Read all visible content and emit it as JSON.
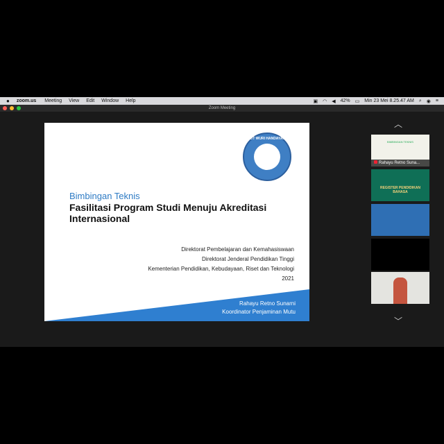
{
  "menubar": {
    "app": "zoom.us",
    "items": [
      "Meeting",
      "View",
      "Edit",
      "Window",
      "Help"
    ],
    "battery": "42%",
    "clock": "Min 23 Mei  8.25.47 AM"
  },
  "window": {
    "title": "Zoom Meeting"
  },
  "slide": {
    "logo_text": "TUT WURI HANDAYANI",
    "subtitle": "Bimbingan Teknis",
    "title": "Fasilitasi Program Studi Menuju Akreditasi Internasional",
    "institution_lines": [
      "Direktorat Pembelajaran dan Kemahasiswaan",
      "Direktorat Jenderal Pendidikan Tinggi",
      "Kementerian Pendidikan, Kebudayaan, Riset dan Teknologi",
      "2021"
    ],
    "presenter_name": "Rahayu Retno Sunarni",
    "presenter_role": "Koordinator Penjaminan Mutu"
  },
  "participants": [
    {
      "name": "Rahayu Retno Suna...",
      "content": "BIMBINGAN TEKNIS"
    },
    {
      "name": "",
      "content": "REGISTER PENDIDIKAN BAHASA"
    },
    {
      "name": "",
      "content": ""
    },
    {
      "name": "",
      "content": ""
    },
    {
      "name": "",
      "content": ""
    }
  ],
  "colors": {
    "accent": "#2e7bc4",
    "band": "#2f7fd0",
    "background": "#000000"
  }
}
